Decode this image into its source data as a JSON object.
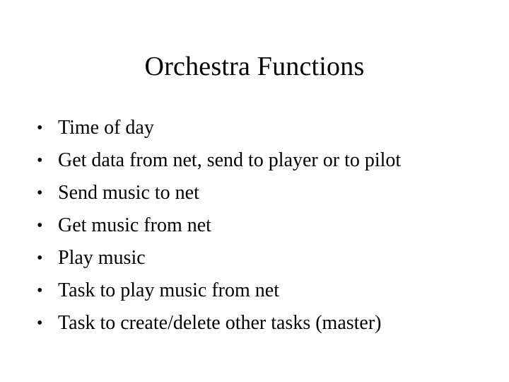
{
  "slide": {
    "title": "Orchestra Functions",
    "background_color": "#ffffff",
    "text_color": "#000000",
    "bullet_marker": "•",
    "bullets": [
      {
        "text": "Time of day"
      },
      {
        "text": "Get data from net, send to player or to pilot"
      },
      {
        "text": "Send music to net"
      },
      {
        "text": "Get music from net"
      },
      {
        "text": "Play music"
      },
      {
        "text": "Task to play music from net"
      },
      {
        "text": "Task to create/delete other tasks (master)"
      }
    ]
  }
}
